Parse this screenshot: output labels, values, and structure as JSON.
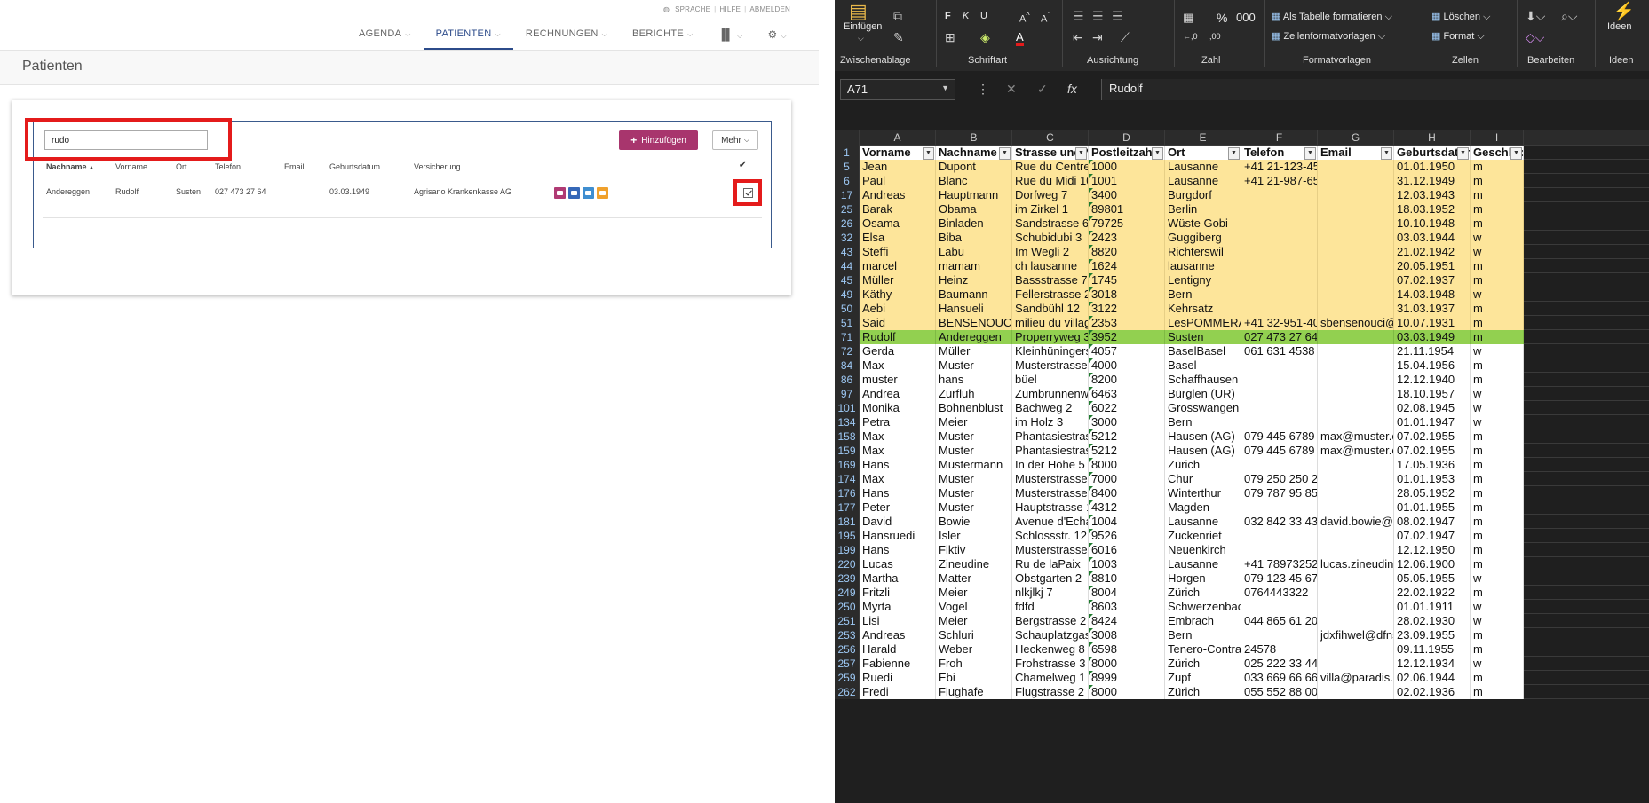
{
  "app": {
    "toplinks": [
      "SPRACHE",
      "HILFE",
      "ABMELDEN"
    ],
    "nav": [
      {
        "label": "AGENDA",
        "active": false
      },
      {
        "label": "PATIENTEN",
        "active": true
      },
      {
        "label": "RECHNUNGEN",
        "active": false
      },
      {
        "label": "BERICHTE",
        "active": false
      }
    ],
    "page_title": "Patienten",
    "search": {
      "value": "rudo"
    },
    "add_button": "Hinzufügen",
    "more_button": "Mehr",
    "table": {
      "columns": [
        "Nachname",
        "Vorname",
        "Ort",
        "Telefon",
        "Email",
        "Geburtsdatum",
        "Versicherung"
      ],
      "rows": [
        {
          "nachname": "Andereggen",
          "vorname": "Rudolf",
          "ort": "Susten",
          "telefon": "027 473 27 64",
          "email": "",
          "geburtsdatum": "03.03.1949",
          "versicherung": "Agrisano Krankenkasse AG"
        }
      ]
    },
    "action_colors": [
      "#b03a74",
      "#3668b8",
      "#3f8ed0",
      "#f0a12c"
    ],
    "highlight_color": "#e41b1b"
  },
  "excel": {
    "ribbon": {
      "groups": [
        "Zwischenablage",
        "Schriftart",
        "Ausrichtung",
        "Zahl",
        "Formatvorlagen",
        "Zellen",
        "Bearbeiten",
        "Ideen"
      ],
      "paste": "Einfügen",
      "als_tabelle": "Als Tabelle formatieren",
      "zellenformat": "Zellenformatvorlagen",
      "loeschen": "Löschen",
      "format": "Format",
      "ideen": "Ideen"
    },
    "name_box": "A71",
    "formula": "Rudolf",
    "col_letters": [
      "A",
      "B",
      "C",
      "D",
      "E",
      "F",
      "G",
      "H",
      "I"
    ],
    "headers": [
      "Vorname",
      "Nachname",
      "Strasse und N",
      "Postleitzahl",
      "Ort",
      "Telefon",
      "Email",
      "Geburtsdatur",
      "Geschlecht"
    ],
    "rows": [
      {
        "n": "5",
        "s": "yel",
        "v": [
          "Jean",
          "Dupont",
          "Rue du Centre 1",
          "1000",
          "Lausanne",
          "+41 21-123-45-67",
          "",
          "01.01.1950",
          "m"
        ]
      },
      {
        "n": "6",
        "s": "yel",
        "v": [
          "Paul",
          "Blanc",
          "Rue du Midi 10",
          "1001",
          "Lausanne",
          "+41 21-987-65-43",
          "",
          "31.12.1949",
          "m"
        ]
      },
      {
        "n": "17",
        "s": "yel",
        "v": [
          "Andreas",
          "Hauptmann",
          "Dorfweg 7",
          "3400",
          "Burgdorf",
          "",
          "",
          "12.03.1943",
          "m"
        ]
      },
      {
        "n": "25",
        "s": "yel",
        "v": [
          "Barak",
          "Obama",
          "im Zirkel 1",
          "89801",
          "Berlin",
          "",
          "",
          "18.03.1952",
          "m"
        ]
      },
      {
        "n": "26",
        "s": "yel",
        "v": [
          "Osama",
          "Binladen",
          "Sandstrasse 666",
          "79725",
          "Wüste Gobi",
          "",
          "",
          "10.10.1948",
          "m"
        ]
      },
      {
        "n": "32",
        "s": "yel",
        "v": [
          "Elsa",
          "Biba",
          "Schubidubi 3",
          "2423",
          "Guggiberg",
          "",
          "",
          "03.03.1944",
          "w"
        ]
      },
      {
        "n": "43",
        "s": "yel",
        "v": [
          "Steffi",
          "Labu",
          "Im Wegli 2",
          "8820",
          "Richterswil",
          "",
          "",
          "21.02.1942",
          "w"
        ]
      },
      {
        "n": "44",
        "s": "yel",
        "v": [
          "marcel",
          "mamam",
          "ch lausanne",
          "1624",
          "lausanne",
          "",
          "",
          "20.05.1951",
          "m"
        ]
      },
      {
        "n": "45",
        "s": "yel",
        "v": [
          "Müller",
          "Heinz",
          "Bassstrasse 7",
          "1745",
          "Lentigny",
          "",
          "",
          "07.02.1937",
          "m"
        ]
      },
      {
        "n": "49",
        "s": "yel",
        "v": [
          "Käthy",
          "Baumann",
          "Fellerstrasse 23",
          "3018",
          "Bern",
          "",
          "",
          "14.03.1948",
          "w"
        ]
      },
      {
        "n": "50",
        "s": "yel",
        "v": [
          "Aebi",
          "Hansueli",
          "Sandbühl 12",
          "3122",
          "Kehrsatz",
          "",
          "",
          "31.03.1937",
          "m"
        ]
      },
      {
        "n": "51",
        "s": "yel",
        "v": [
          "Said",
          "BENSENOUCI",
          "milieu du village",
          "2353",
          "LesPOMMERATS",
          "+41 32-951-40-16",
          "sbensenouci@h",
          "10.07.1931",
          "m"
        ]
      },
      {
        "n": "71",
        "s": "grn",
        "v": [
          "Rudolf",
          "Andereggen",
          "Properryweg 3",
          "3952",
          "Susten",
          "027 473 27 64",
          "",
          "03.03.1949",
          "m"
        ]
      },
      {
        "n": "72",
        "s": "wht",
        "v": [
          "Gerda",
          "Müller",
          "Kleinhüningerst",
          "4057",
          "BaselBasel",
          "061 631 4538",
          "",
          "21.11.1954",
          "w"
        ]
      },
      {
        "n": "84",
        "s": "wht",
        "v": [
          "Max",
          "Muster",
          "Musterstrasse 7",
          "4000",
          "Basel",
          "",
          "",
          "15.04.1956",
          "m"
        ]
      },
      {
        "n": "86",
        "s": "wht",
        "v": [
          "muster",
          "hans",
          "büel",
          "8200",
          "Schaffhausen",
          "",
          "",
          "12.12.1940",
          "m"
        ]
      },
      {
        "n": "97",
        "s": "wht",
        "v": [
          "Andrea",
          "Zurfluh",
          "Zumbrunnenwe",
          "6463",
          "Bürglen (UR)",
          "",
          "",
          "18.10.1957",
          "w"
        ]
      },
      {
        "n": "101",
        "s": "wht",
        "v": [
          "Monika",
          "Bohnenblust",
          "Bachweg 2",
          "6022",
          "Grosswangen",
          "",
          "",
          "02.08.1945",
          "w"
        ]
      },
      {
        "n": "134",
        "s": "wht",
        "v": [
          "Petra",
          "Meier",
          "im Holz 3",
          "3000",
          "Bern",
          "",
          "",
          "01.01.1947",
          "w"
        ]
      },
      {
        "n": "158",
        "s": "wht",
        "v": [
          "Max",
          "Muster",
          "Phantasiestrass",
          "5212",
          "Hausen (AG)",
          "079 445 6789",
          "max@muster.ch",
          "07.02.1955",
          "m"
        ]
      },
      {
        "n": "159",
        "s": "wht",
        "v": [
          "Max",
          "Muster",
          "Phantasiestrass",
          "5212",
          "Hausen (AG)",
          "079 445 6789",
          "max@muster.ch",
          "07.02.1955",
          "m"
        ]
      },
      {
        "n": "169",
        "s": "wht",
        "v": [
          "Hans",
          "Mustermann",
          "In der Höhe 5",
          "8000",
          "Zürich",
          "",
          "",
          "17.05.1936",
          "m"
        ]
      },
      {
        "n": "174",
        "s": "wht",
        "v": [
          "Max",
          "Muster",
          "Musterstrasse 1",
          "7000",
          "Chur",
          "079 250 250 250",
          "",
          "01.01.1953",
          "m"
        ]
      },
      {
        "n": "176",
        "s": "wht",
        "v": [
          "Hans",
          "Muster",
          "Musterstrasse 3",
          "8400",
          "Winterthur",
          "079 787 95 85",
          "",
          "28.05.1952",
          "m"
        ]
      },
      {
        "n": "177",
        "s": "wht",
        "v": [
          "Peter",
          "Muster",
          "Hauptstrasse 10",
          "4312",
          "Magden",
          "",
          "",
          "01.01.1955",
          "m"
        ]
      },
      {
        "n": "181",
        "s": "wht",
        "v": [
          "David",
          "Bowie",
          "Avenue d'Echall",
          "1004",
          "Lausanne",
          "032 842 33 43",
          "david.bowie@m",
          "08.02.1947",
          "m"
        ]
      },
      {
        "n": "195",
        "s": "wht",
        "v": [
          "Hansruedi",
          "Isler",
          "Schlossstr. 12",
          "9526",
          "Zuckenriet",
          "",
          "",
          "07.02.1947",
          "m"
        ]
      },
      {
        "n": "199",
        "s": "wht",
        "v": [
          "Hans",
          "Fiktiv",
          "Musterstrasse 2",
          "6016",
          "Neuenkirch",
          "",
          "",
          "12.12.1950",
          "m"
        ]
      },
      {
        "n": "220",
        "s": "wht",
        "v": [
          "Lucas",
          "Zineudine",
          "Ru de laPaix",
          "1003",
          "Lausanne",
          "+41 789732525",
          "lucas.zineudine",
          "12.06.1900",
          "m"
        ]
      },
      {
        "n": "239",
        "s": "wht",
        "v": [
          "Martha",
          "Matter",
          "Obstgarten 2",
          "8810",
          "Horgen",
          "079 123 45 67",
          "",
          "05.05.1955",
          "w"
        ]
      },
      {
        "n": "249",
        "s": "wht",
        "v": [
          "Fritzli",
          "Meier",
          "nlkjlkj 7",
          "8004",
          "Zürich",
          "0764443322",
          "",
          "22.02.1922",
          "m"
        ]
      },
      {
        "n": "250",
        "s": "wht",
        "v": [
          "Myrta",
          "Vogel",
          "fdfd",
          "8603",
          "Schwerzenbach",
          "",
          "",
          "01.01.1911",
          "w"
        ]
      },
      {
        "n": "251",
        "s": "wht",
        "v": [
          "Lisi",
          "Meier",
          "Bergstrasse 2",
          "8424",
          "Embrach",
          "044 865 61 20",
          "",
          "28.02.1930",
          "w"
        ]
      },
      {
        "n": "253",
        "s": "wht",
        "v": [
          "Andreas",
          "Schluri",
          "Schauplatzgasse",
          "3008",
          "Bern",
          "",
          "jdxfihwel@dfns",
          "23.09.1955",
          "m"
        ]
      },
      {
        "n": "256",
        "s": "wht",
        "v": [
          "Harald",
          "Weber",
          "Heckenweg 8",
          "6598",
          "Tenero-Contra",
          "24578",
          "",
          "09.11.1955",
          "m"
        ]
      },
      {
        "n": "257",
        "s": "wht",
        "v": [
          "Fabienne",
          "Froh",
          "Frohstrasse 3",
          "8000",
          "Zürich",
          "025 222 33 44",
          "",
          "12.12.1934",
          "w"
        ]
      },
      {
        "n": "259",
        "s": "wht",
        "v": [
          "Ruedi",
          "Ebi",
          "Chamelweg 1",
          "8999",
          "Zupf",
          "033 669 66 66",
          "villa@paradis.eu",
          "02.06.1944",
          "m"
        ]
      },
      {
        "n": "262",
        "s": "wht",
        "v": [
          "Fredi",
          "Flughafe",
          "Flugstrasse 2",
          "8000",
          "Zürich",
          "055 552 88 00",
          "",
          "02.02.1936",
          "m"
        ]
      }
    ]
  }
}
